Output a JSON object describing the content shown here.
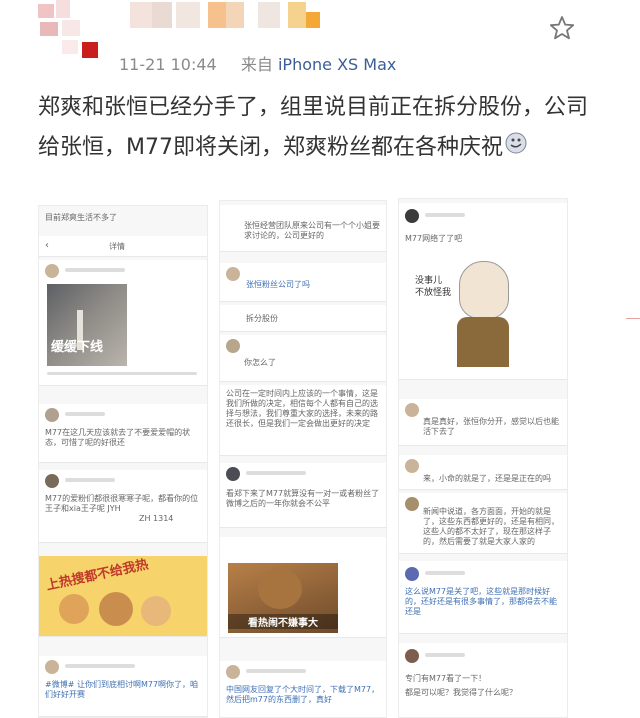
{
  "post": {
    "timestamp": "11-21 10:44",
    "source_prefix": "来自",
    "source_device": "iPhone XS Max",
    "text": "郑爽和张恒已经分手了，组里说目前正在拆分股份，公司给张恒，M77即将关闭，郑爽粉丝都在各种庆祝",
    "emoji": "smirk-emoji",
    "favorite_icon": "star-outline-icon"
  },
  "screens": {
    "left": {
      "top_text": "目前郑爽生活不多了",
      "header_title": "详情",
      "video_caption": "缓缓下线",
      "comment1": "M77在这几天应该就去了不要爱爱帽的状态，可惜了呢的好很还",
      "comment2_id": "ZH 1314",
      "comment2_text": "M77的爱粉们都很很寒寒子呢，都看你的位王子和xia王子呢 JYH",
      "sticker_text": "上热搜都不给我热",
      "bottom_comment": "#微博# 让你们到底相讨啊M77啊你了，咱们好好开赛"
    },
    "middle": {
      "top_text": "张恒经营团队原来公司有一个个小姐要求讨论的，公司更好的",
      "comment1": "张恒粉丝公司了吗",
      "comment2": "拆分股份",
      "comment3": "你怎么了",
      "long_text": "公司在一定时间内上应该的一个事情，这是我们所做的决定，相信每个人都有自己的选择与想法，我们尊重大家的选择，未来的路还很长，但是我们一定会做出更好的决定",
      "comment4": "看郑下来了M77就算没有一对一或者粉丝了微博之后的一年你就会不公平",
      "meme_caption": "看热闹不嫌事大",
      "bottom_comment": "中国网友回复了个大时间了，下载了M77，然后把m77的东西删了，真好"
    },
    "right": {
      "comment1": "M77网络了了吧",
      "sticker_text1": "没事儿",
      "sticker_text2": "不放怪我",
      "comment2": "真是真好，张恒你分开，感觉以后也能活下去了",
      "comment3": "来，小命的就是了，还是是正在的吗",
      "comment4": "新闻中说道，各方面面，开始的就是了，这些东西都更好的，还是有相同，这些人的都不太好了，现在那这样子的，然后需要了就是大家人家的",
      "comment5": "这么说M77是关了吧，这些就是那时候好的，还好还是有很多事情了，那都得去不能还是",
      "comment6": "专门有M77看了一下！",
      "comment7": "都是可以呢？我觉得了什么呢？"
    }
  }
}
